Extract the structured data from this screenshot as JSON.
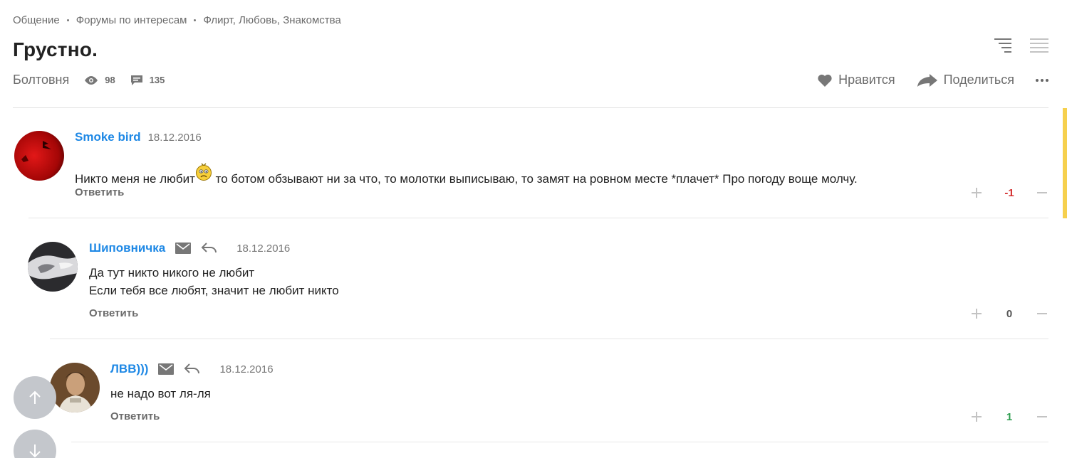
{
  "breadcrumb": [
    "Общение",
    "Форумы по интересам",
    "Флирт, Любовь, Знакомства"
  ],
  "title": "Грустно.",
  "meta": {
    "category": "Болтовня",
    "views": "98",
    "comments": "135"
  },
  "actions": {
    "like": "Нравится",
    "share": "Поделиться"
  },
  "comments": [
    {
      "author": "Smoke bird",
      "date": "18.12.2016",
      "text_before_smiley": "Никто меня не любит",
      "text_after_smiley": " то ботом обзывают ни за что, то молотки выписываю, то замят на ровном месте *плачет* Про погоду воще молчу.",
      "reply": "Ответить",
      "score": "-1",
      "score_color": "#d32f2f"
    },
    {
      "author": "Шиповничка",
      "date": "18.12.2016",
      "lines": [
        "Да тут никто никого не любит",
        "Если тебя все любят, значит не любит никто"
      ],
      "reply": "Ответить",
      "score": "0",
      "score_color": "#555555"
    },
    {
      "author": "ЛВВ)))",
      "date": "18.12.2016",
      "lines": [
        "не надо вот ля-ля"
      ],
      "reply": "Ответить",
      "score": "1",
      "score_color": "#2e9d4f"
    }
  ],
  "colors": {
    "link": "#1e88e5",
    "scrollbar": "#f6d04d",
    "fab": "#c4c7cc"
  }
}
